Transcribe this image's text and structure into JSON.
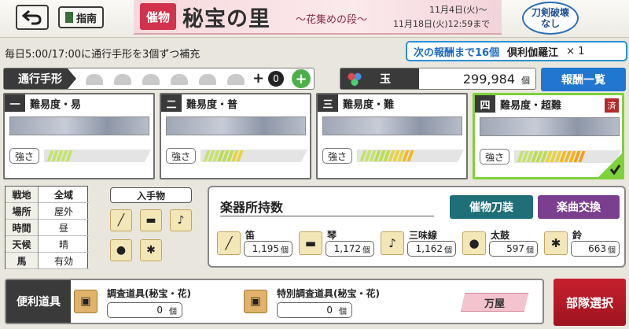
{
  "header": {
    "back_icon": "back-arrow-icon",
    "guide_label": "指南",
    "banner": {
      "tag": "催物",
      "title": "秘宝の里",
      "subtitle": "〜花集めの段〜",
      "date_start": "11月4日(火)〜",
      "date_end": "11月18日(火)12:59まで"
    },
    "break_badge": {
      "line1": "刀剣破壊",
      "line2": "なし"
    }
  },
  "info": {
    "refill_text": "毎日5:00/17:00に通行手形を3個ずつ補充",
    "next_reward_text": "次の報酬まで16個",
    "next_reward_item": "倶利伽羅江",
    "next_reward_qty": "× 1"
  },
  "pass": {
    "label": "通行手形",
    "slots": 6,
    "extra_prefix": "+",
    "extra_count": "0",
    "add_icon": "plus-circle-icon"
  },
  "currency": {
    "label": "玉",
    "value": "299,984",
    "unit": "個",
    "icon": "gem-cluster-icon"
  },
  "reward_list_label": "報酬一覧",
  "difficulties": [
    {
      "num": "一",
      "title": "難易度・易",
      "strength_label": "強さ",
      "level": 1,
      "selected": false,
      "done": false
    },
    {
      "num": "二",
      "title": "難易度・普",
      "strength_label": "強さ",
      "level": 2,
      "selected": false,
      "done": false
    },
    {
      "num": "三",
      "title": "難易度・難",
      "strength_label": "強さ",
      "level": 3,
      "selected": false,
      "done": false
    },
    {
      "num": "四",
      "title": "難易度・超難",
      "strength_label": "強さ",
      "level": 4,
      "selected": true,
      "done": true,
      "done_label": "済"
    }
  ],
  "conditions": {
    "rows": [
      {
        "key": "戦地",
        "value": "全域"
      },
      {
        "key": "場所",
        "value": "屋外"
      },
      {
        "key": "時間",
        "value": "昼"
      },
      {
        "key": "天候",
        "value": "晴"
      },
      {
        "key": "馬",
        "value": "有効"
      }
    ]
  },
  "acquisitions": {
    "title": "入手物",
    "items": [
      "flute-icon",
      "koto-icon",
      "shamisen-icon",
      "taiko-icon",
      "bell-icon"
    ]
  },
  "instruments": {
    "title": "楽器所持数",
    "weapon_button": "催物刀装",
    "music_button": "楽曲交換",
    "items": [
      {
        "name": "笛",
        "count": "1,195",
        "unit": "個",
        "icon": "flute-icon"
      },
      {
        "name": "琴",
        "count": "1,172",
        "unit": "個",
        "icon": "koto-icon"
      },
      {
        "name": "三味線",
        "count": "1,162",
        "unit": "個",
        "icon": "shamisen-icon"
      },
      {
        "name": "太鼓",
        "count": "597",
        "unit": "個",
        "icon": "taiko-icon"
      },
      {
        "name": "鈴",
        "count": "663",
        "unit": "個",
        "icon": "bell-icon"
      }
    ]
  },
  "tools": {
    "label": "便利道具",
    "items": [
      {
        "name": "調査道具(秘宝・花)",
        "count": "0",
        "unit": "個",
        "icon": "survey-tool-icon"
      },
      {
        "name": "特別調査道具(秘宝・花)",
        "count": "0",
        "unit": "個",
        "icon": "special-survey-tool-icon"
      }
    ],
    "shop_label": "万屋"
  },
  "unit_select_label": "部隊選択",
  "colors": {
    "accent_blue": "#2177cf",
    "select_green": "#7dd13a",
    "unit_red": "#c7202e",
    "weapon_teal": "#1e6f78",
    "music_purple": "#7b3f8f"
  }
}
